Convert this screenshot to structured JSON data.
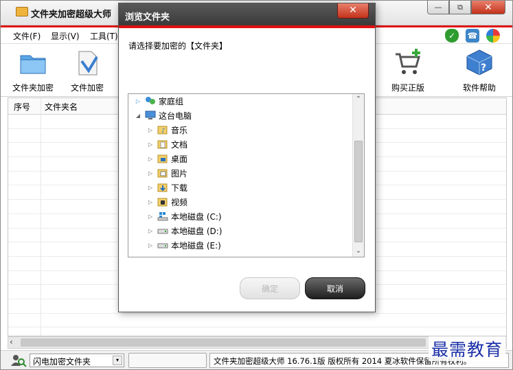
{
  "app": {
    "title": "文件夹加密超级大师",
    "window_controls": {
      "minimize": "—",
      "restore": "⧉",
      "close": "✕"
    }
  },
  "menu": {
    "items": [
      "文件(F)",
      "显示(V)",
      "工具(T)"
    ],
    "icons": [
      "shield-check-icon",
      "phone-icon",
      "colorful-flower-icon"
    ]
  },
  "toolbar": {
    "left": [
      {
        "label": "文件夹加密",
        "icon": "folder-lock-icon"
      },
      {
        "label": "文件加密",
        "icon": "file-lock-icon"
      }
    ],
    "right": [
      {
        "label": "购买正版",
        "icon": "shopping-cart-icon"
      },
      {
        "label": "软件帮助",
        "icon": "help-cube-icon"
      }
    ]
  },
  "table": {
    "columns": [
      "序号",
      "文件夹名"
    ]
  },
  "status": {
    "mode_select": "闪电加密文件夹",
    "field_value": "",
    "copyright": "文件夹加密超级大师 16.76.1版 版权所有 2014 夏冰软件保留所有权利。"
  },
  "watermark": "最需教育",
  "dialog": {
    "title": "浏览文件夹",
    "close": "✕",
    "prompt": "请选择要加密的【文件夹】",
    "tree": [
      {
        "label": "家庭组",
        "level": 0,
        "expanded": false,
        "icon": "homegroup-icon"
      },
      {
        "label": "这台电脑",
        "level": 0,
        "expanded": true,
        "icon": "computer-icon"
      },
      {
        "label": "音乐",
        "level": 1,
        "expanded": false,
        "icon": "music-folder-icon"
      },
      {
        "label": "文档",
        "level": 1,
        "expanded": false,
        "icon": "documents-folder-icon"
      },
      {
        "label": "桌面",
        "level": 1,
        "expanded": false,
        "icon": "desktop-folder-icon"
      },
      {
        "label": "图片",
        "level": 1,
        "expanded": false,
        "icon": "pictures-folder-icon"
      },
      {
        "label": "下载",
        "level": 1,
        "expanded": false,
        "icon": "downloads-folder-icon"
      },
      {
        "label": "视频",
        "level": 1,
        "expanded": false,
        "icon": "videos-folder-icon"
      },
      {
        "label": "本地磁盘 (C:)",
        "level": 1,
        "expanded": false,
        "icon": "system-drive-icon"
      },
      {
        "label": "本地磁盘 (D:)",
        "level": 1,
        "expanded": false,
        "icon": "drive-icon"
      },
      {
        "label": "本地磁盘 (E:)",
        "level": 1,
        "expanded": false,
        "icon": "drive-icon"
      }
    ],
    "ok_label": "确定",
    "cancel_label": "取消"
  }
}
